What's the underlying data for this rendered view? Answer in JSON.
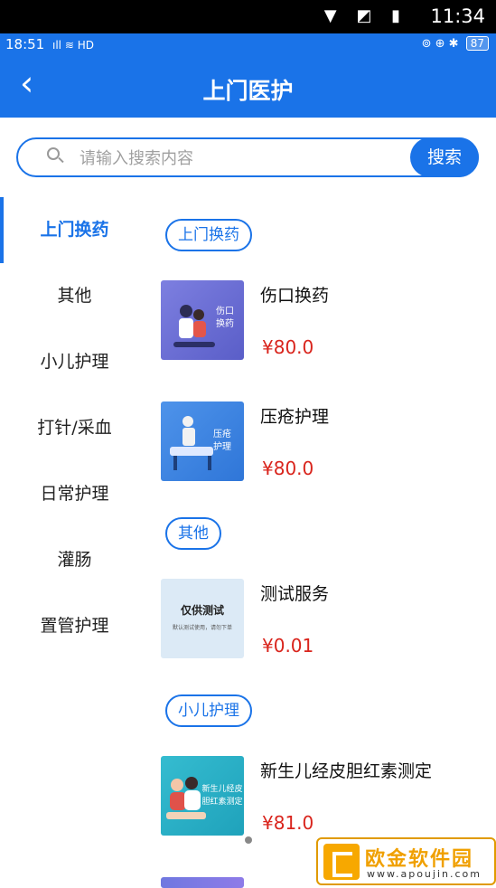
{
  "system_bar": {
    "time": "11:34",
    "icons": "▼ ◩ ▮"
  },
  "app_status": {
    "time": "18:51",
    "left_icons": "ıll ≋ HD",
    "right_icons": "⊚ ⊕ ✱",
    "battery": "87"
  },
  "header": {
    "back": "‹",
    "title": "上门医护"
  },
  "search": {
    "placeholder": "请输入搜索内容",
    "button": "搜索"
  },
  "sidebar": {
    "items": [
      {
        "label": "上门换药",
        "active": true
      },
      {
        "label": "其他"
      },
      {
        "label": "小儿护理"
      },
      {
        "label": "打针/采血"
      },
      {
        "label": "日常护理"
      },
      {
        "label": "灌肠"
      },
      {
        "label": "置管护理"
      }
    ]
  },
  "sections": [
    {
      "label": "上门换药"
    },
    {
      "label": "其他"
    },
    {
      "label": "小儿护理"
    }
  ],
  "products": [
    {
      "name": "伤口换药",
      "price": "¥80.0",
      "thumb_caption": "伤口\n换药",
      "thumb_color": "#6b6fd6"
    },
    {
      "name": "压疮护理",
      "price": "¥80.0",
      "thumb_caption": "压疮\n护理",
      "thumb_color": "#3f86e6"
    },
    {
      "name": "测试服务",
      "price": "¥0.01",
      "thumb_caption": "仅供测试",
      "thumb_subcaption": "默认测试使用，请勿下单",
      "thumb_color": "#dceaf6"
    },
    {
      "name": "新生儿经皮胆红素测定",
      "price": "¥81.0",
      "thumb_caption": "新生儿经皮\n胆红素测定",
      "thumb_color": "#2bb0c8"
    }
  ],
  "watermark": {
    "text": "欧金软件园",
    "url": "www.apoujin.com"
  },
  "colors": {
    "primary": "#1a73e8",
    "price": "#d9241c"
  }
}
